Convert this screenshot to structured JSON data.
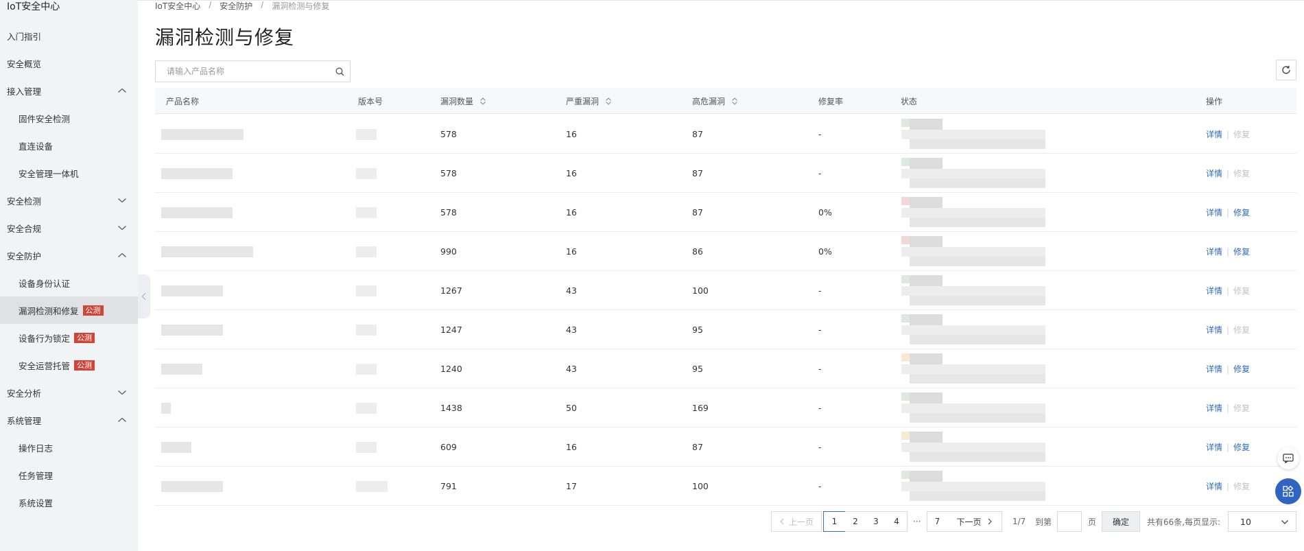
{
  "app": {
    "title": "IoT安全中心"
  },
  "sidebar": {
    "items": [
      {
        "label": "入门指引",
        "level": 1,
        "chevron": ""
      },
      {
        "label": "安全概览",
        "level": 1,
        "chevron": ""
      },
      {
        "label": "接入管理",
        "level": 1,
        "chevron": "up"
      },
      {
        "label": "固件安全检测",
        "level": 2,
        "chevron": ""
      },
      {
        "label": "直连设备",
        "level": 2,
        "chevron": ""
      },
      {
        "label": "安全管理一体机",
        "level": 2,
        "chevron": ""
      },
      {
        "label": "安全检测",
        "level": 1,
        "chevron": "down"
      },
      {
        "label": "安全合规",
        "level": 1,
        "chevron": "down"
      },
      {
        "label": "安全防护",
        "level": 1,
        "chevron": "up"
      },
      {
        "label": "设备身份认证",
        "level": 2,
        "chevron": ""
      },
      {
        "label": "漏洞检测和修复",
        "level": 2,
        "chevron": "",
        "badge": "公测",
        "active": true
      },
      {
        "label": "设备行为锁定",
        "level": 2,
        "chevron": "",
        "badge": "公测"
      },
      {
        "label": "安全运营托管",
        "level": 2,
        "chevron": "",
        "badge": "公测"
      },
      {
        "label": "安全分析",
        "level": 1,
        "chevron": "down"
      },
      {
        "label": "系统管理",
        "level": 1,
        "chevron": "up"
      },
      {
        "label": "操作日志",
        "level": 2,
        "chevron": ""
      },
      {
        "label": "任务管理",
        "level": 2,
        "chevron": ""
      },
      {
        "label": "系统设置",
        "level": 2,
        "chevron": ""
      }
    ]
  },
  "breadcrumb": [
    "IoT安全中心",
    "安全防护",
    "漏洞检测与修复"
  ],
  "page_title": "漏洞检测与修复",
  "search": {
    "placeholder": "请输入产品名称",
    "value": ""
  },
  "table": {
    "columns": {
      "name": "产品名称",
      "version": "版本号",
      "vuln_count": "漏洞数量",
      "critical": "严重漏洞",
      "high": "高危漏洞",
      "fix_rate": "修复率",
      "status": "状态",
      "actions": "操作"
    },
    "detail_label": "详情",
    "fix_label": "修复",
    "rows": [
      {
        "vuln_count": "578",
        "critical": "16",
        "high": "87",
        "fix_rate": "-",
        "fix_enabled": false,
        "status_color": "g"
      },
      {
        "vuln_count": "578",
        "critical": "16",
        "high": "87",
        "fix_rate": "-",
        "fix_enabled": false,
        "status_color": "g"
      },
      {
        "vuln_count": "578",
        "critical": "16",
        "high": "87",
        "fix_rate": "0%",
        "fix_enabled": true,
        "status_color": "r"
      },
      {
        "vuln_count": "990",
        "critical": "16",
        "high": "86",
        "fix_rate": "0%",
        "fix_enabled": true,
        "status_color": "r"
      },
      {
        "vuln_count": "1267",
        "critical": "43",
        "high": "100",
        "fix_rate": "-",
        "fix_enabled": false,
        "status_color": "g"
      },
      {
        "vuln_count": "1247",
        "critical": "43",
        "high": "95",
        "fix_rate": "-",
        "fix_enabled": false,
        "status_color": "g"
      },
      {
        "vuln_count": "1240",
        "critical": "43",
        "high": "95",
        "fix_rate": "-",
        "fix_enabled": true,
        "status_color": "y"
      },
      {
        "vuln_count": "1438",
        "critical": "50",
        "high": "169",
        "fix_rate": "-",
        "fix_enabled": false,
        "status_color": "g"
      },
      {
        "vuln_count": "609",
        "critical": "16",
        "high": "87",
        "fix_rate": "-",
        "fix_enabled": true,
        "status_color": "y"
      },
      {
        "vuln_count": "791",
        "critical": "17",
        "high": "100",
        "fix_rate": "-",
        "fix_enabled": false,
        "status_color": "g"
      }
    ]
  },
  "pagination": {
    "prev_label": "上一页",
    "next_label": "下一页",
    "pages": [
      "1",
      "2",
      "3",
      "4"
    ],
    "ellipsis": "···",
    "last_page": "7",
    "current": "1",
    "page_info": "1/7",
    "goto_label": "到第",
    "goto_suffix": "页",
    "goto_value": "",
    "confirm_label": "确定",
    "summary": "共有66条,每页显示:",
    "page_size": "10"
  },
  "colors": {
    "accent": "#2f6ab8",
    "badge": "#d0453a",
    "sidebar_bg": "#f2f3f5",
    "fab": "#2f64c3"
  },
  "icons": {
    "search": "search-icon",
    "refresh": "refresh-icon",
    "chat": "chat-icon",
    "apps": "apps-icon"
  }
}
